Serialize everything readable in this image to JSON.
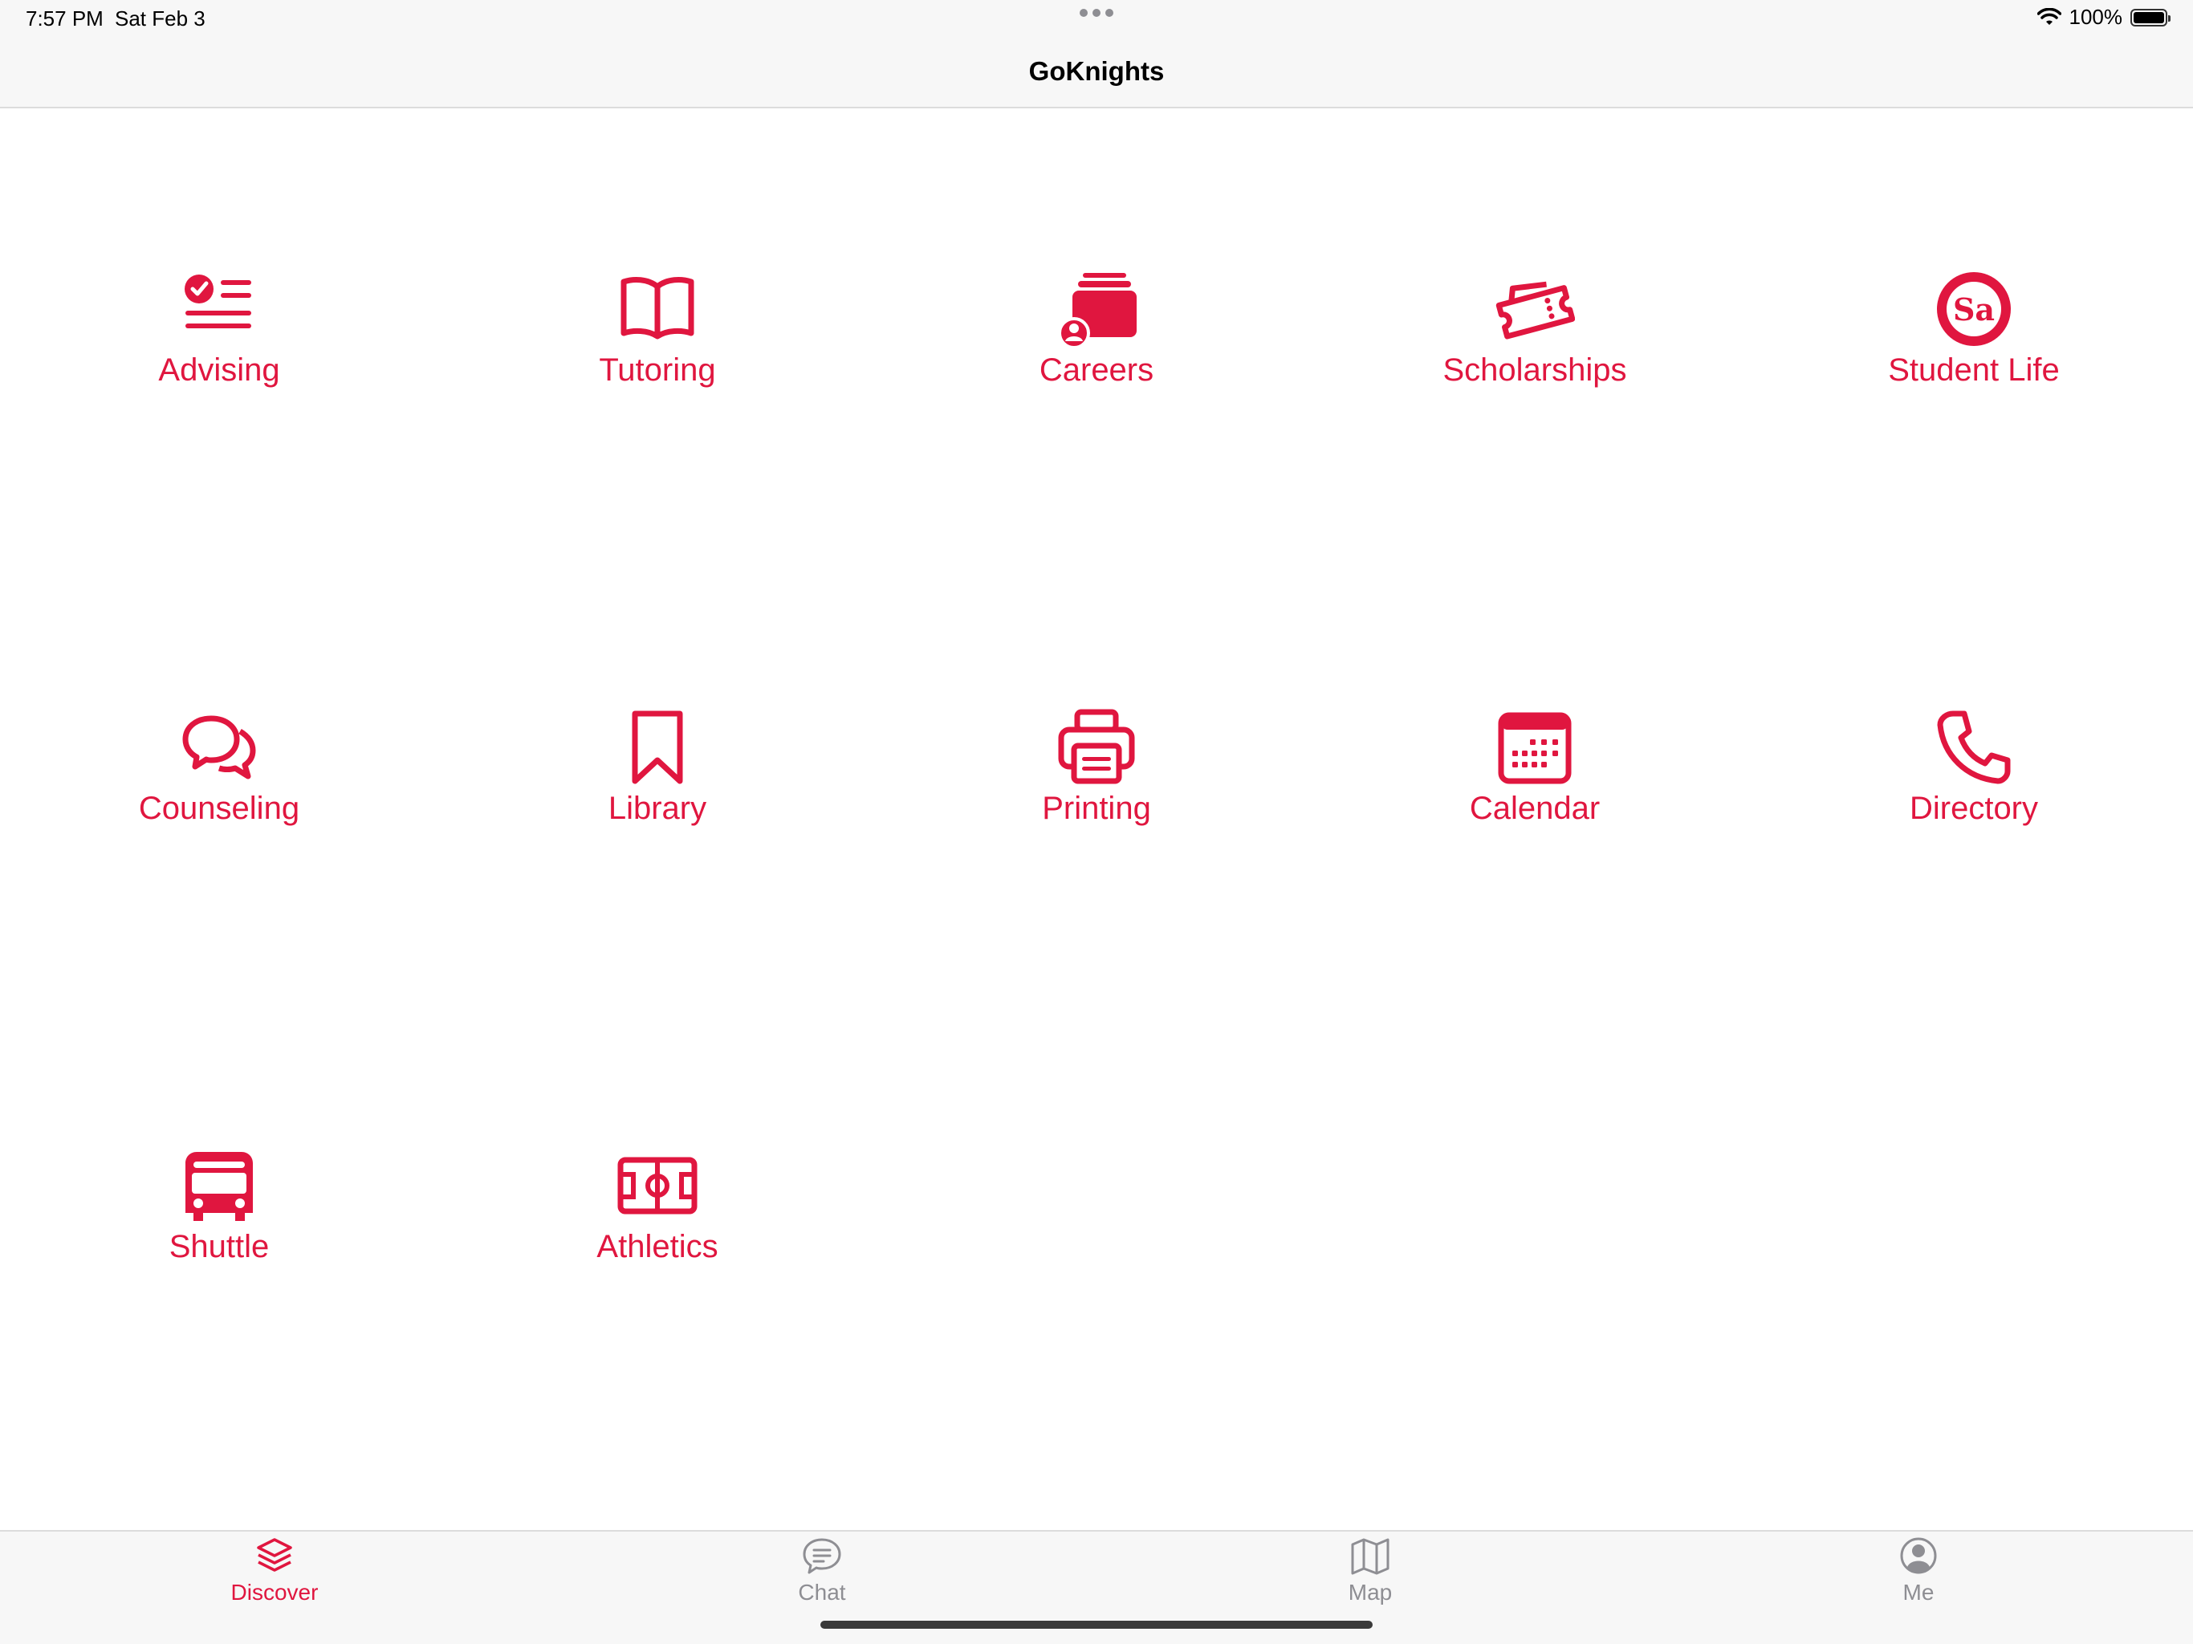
{
  "status_bar": {
    "time": "7:57 PM",
    "date": "Sat Feb 3",
    "battery": "100%"
  },
  "nav": {
    "title": "GoKnights"
  },
  "accent_color": "#e0163f",
  "tiles": [
    {
      "label": "Advising",
      "icon": "checklist-icon"
    },
    {
      "label": "Tutoring",
      "icon": "book-icon"
    },
    {
      "label": "Careers",
      "icon": "career-folder-icon"
    },
    {
      "label": "Scholarships",
      "icon": "ticket-icon"
    },
    {
      "label": "Student Life",
      "icon": "student-activities-logo"
    },
    {
      "label": "Counseling",
      "icon": "chat-bubbles-icon"
    },
    {
      "label": "Library",
      "icon": "bookmark-icon"
    },
    {
      "label": "Printing",
      "icon": "printer-icon"
    },
    {
      "label": "Calendar",
      "icon": "calendar-icon"
    },
    {
      "label": "Directory",
      "icon": "phone-icon"
    },
    {
      "label": "Shuttle",
      "icon": "bus-icon"
    },
    {
      "label": "Athletics",
      "icon": "field-icon"
    }
  ],
  "tab_bar": {
    "items": [
      {
        "label": "Discover",
        "icon": "layers-icon",
        "active": true
      },
      {
        "label": "Chat",
        "icon": "chat-bubble-icon",
        "active": false
      },
      {
        "label": "Map",
        "icon": "map-icon",
        "active": false
      },
      {
        "label": "Me",
        "icon": "person-circle-icon",
        "active": false
      }
    ]
  }
}
